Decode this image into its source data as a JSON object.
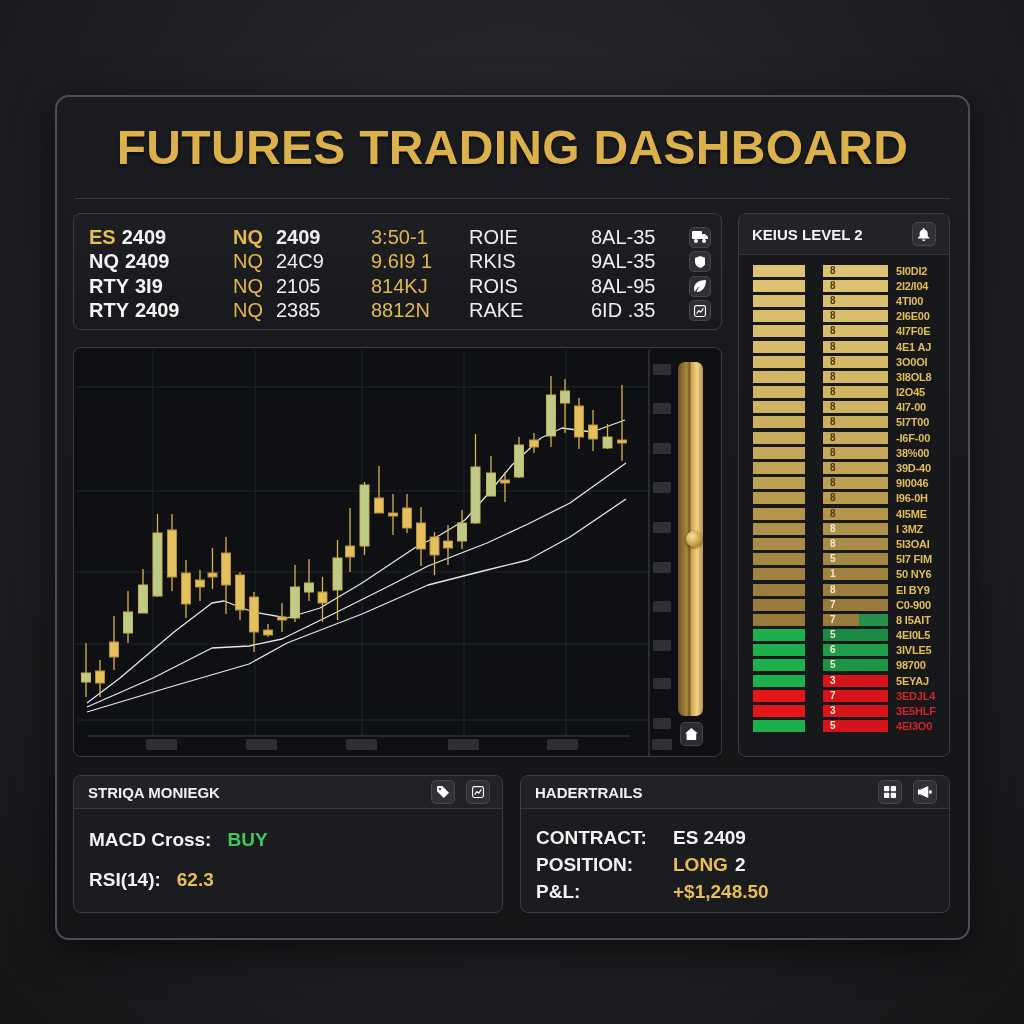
{
  "title": "FUTURES TRADING DASHBOARD",
  "ticker": {
    "rows": [
      {
        "selected": true,
        "symbol": "ES",
        "contract": "2409",
        "cells": [
          "NQ",
          "2409",
          "3:50-1",
          "ROIE",
          "8AL-35"
        ]
      },
      {
        "selected": false,
        "symbol": "NQ",
        "contract": "2409",
        "cells": [
          "NQ",
          "24C9",
          "9.6I9 1",
          "RKIS",
          "9AL-35"
        ]
      },
      {
        "selected": false,
        "symbol": "RTY",
        "contract": "3I9",
        "cells": [
          "NQ",
          "2105",
          "814KJ",
          "ROIS",
          "8AL-95"
        ]
      },
      {
        "selected": false,
        "symbol": "RTY",
        "contract": "2409",
        "cells": [
          "NQ",
          "2385",
          "8812N",
          "RAKE",
          "6ID .35"
        ]
      }
    ]
  },
  "chart": {
    "zoom_slider": {
      "level": 0.5
    }
  },
  "level2": {
    "title": "KEIUS LEVEL 2",
    "rows": [
      {
        "left": {
          "color": "#dcc272"
        },
        "right": {
          "color": "#dcc272",
          "label": "8"
        },
        "price": {
          "text": "5I0DI2",
          "color": "#e2be55"
        }
      },
      {
        "left": {
          "color": "#dbc170"
        },
        "right": {
          "color": "#dbc170",
          "label": "8"
        },
        "price": {
          "text": "2I2/I04",
          "color": "#e2be55"
        }
      },
      {
        "left": {
          "color": "#dac06e"
        },
        "right": {
          "color": "#dac06e",
          "label": "8"
        },
        "price": {
          "text": "4TI00",
          "color": "#e2be55"
        }
      },
      {
        "left": {
          "color": "#d9be6c"
        },
        "right": {
          "color": "#d9be6c",
          "label": "8"
        },
        "price": {
          "text": "2I6E00",
          "color": "#e2be55"
        }
      },
      {
        "left": {
          "color": "#d8bd6a"
        },
        "right": {
          "color": "#d8bd6a",
          "label": "8"
        },
        "price": {
          "text": "4I7F0E",
          "color": "#e2be55"
        }
      },
      {
        "left": {
          "color": "#d7bb68"
        },
        "right": {
          "color": "#d7bb68",
          "label": "8"
        },
        "price": {
          "text": "4E1 AJ",
          "color": "#e2be55"
        }
      },
      {
        "left": {
          "color": "#d5b966"
        },
        "right": {
          "color": "#d5b966",
          "label": "8"
        },
        "price": {
          "text": "3O0OI",
          "color": "#e2be55"
        }
      },
      {
        "left": {
          "color": "#d3b764"
        },
        "right": {
          "color": "#d3b764",
          "label": "8"
        },
        "price": {
          "text": "3I8OL8",
          "color": "#e2be55"
        }
      },
      {
        "left": {
          "color": "#d1b462"
        },
        "right": {
          "color": "#d1b462",
          "label": "8"
        },
        "price": {
          "text": "I2O45",
          "color": "#e2be55"
        }
      },
      {
        "left": {
          "color": "#cfb260"
        },
        "right": {
          "color": "#cfb260",
          "label": "8"
        },
        "price": {
          "text": "4I7-00",
          "color": "#e2be55"
        }
      },
      {
        "left": {
          "color": "#ccaf5e"
        },
        "right": {
          "color": "#ccaf5e",
          "label": "8"
        },
        "price": {
          "text": "5I7T00",
          "color": "#e2be55"
        }
      },
      {
        "left": {
          "color": "#c9ac5b"
        },
        "right": {
          "color": "#c9ac5b",
          "label": "8"
        },
        "price": {
          "text": "-I6F-00",
          "color": "#e2be55"
        }
      },
      {
        "left": {
          "color": "#c5a858"
        },
        "right": {
          "color": "#c5a858",
          "label": "8"
        },
        "price": {
          "text": "38%00",
          "color": "#e2be55"
        }
      },
      {
        "left": {
          "color": "#c1a455"
        },
        "right": {
          "color": "#c1a455",
          "label": "8"
        },
        "price": {
          "text": "39D-40",
          "color": "#e2be55"
        }
      },
      {
        "left": {
          "color": "#bda052"
        },
        "right": {
          "color": "#bda052",
          "label": "8"
        },
        "price": {
          "text": "9I0046",
          "color": "#e2be55"
        }
      },
      {
        "left": {
          "color": "#b89b4f"
        },
        "right": {
          "color": "#b89b4f",
          "label": "8"
        },
        "price": {
          "text": "I96-0H",
          "color": "#e2be55"
        }
      },
      {
        "left": {
          "color": "#b3964c"
        },
        "right": {
          "color": "#b3964c",
          "label": "8"
        },
        "price": {
          "text": "4I5ME",
          "color": "#e2be55"
        }
      },
      {
        "left": {
          "color": "#ae9149"
        },
        "right": {
          "color": "#ae9149",
          "label": "8"
        },
        "price": {
          "text": "I 3MZ",
          "color": "#e2be55"
        }
      },
      {
        "left": {
          "color": "#a98c46"
        },
        "right": {
          "color": "#a98c46",
          "label": "8"
        },
        "price": {
          "text": "5I3OAI",
          "color": "#e2be55"
        }
      },
      {
        "left": {
          "color": "#a48743"
        },
        "right": {
          "color": "#a48743",
          "label": "5"
        },
        "price": {
          "text": "5I7 FIM",
          "color": "#e2be55"
        }
      },
      {
        "left": {
          "color": "#a08341"
        },
        "right": {
          "color": "#a08341",
          "label": "1"
        },
        "price": {
          "text": "50 NY6",
          "color": "#e2be55"
        }
      },
      {
        "left": {
          "color": "#9c7f3f"
        },
        "right": {
          "color": "#9c7f3f",
          "label": "8"
        },
        "price": {
          "text": "EI BY9",
          "color": "#e2be55"
        }
      },
      {
        "left": {
          "color": "#997c3d"
        },
        "right": {
          "color": "#997c3d",
          "label": "7"
        },
        "price": {
          "text": "C0-900",
          "color": "#e2be55"
        }
      },
      {
        "left": {
          "color": "#977a3c"
        },
        "right": {
          "color": "#977a3c",
          "label": "7",
          "segment": {
            "color": "#24904b"
          }
        },
        "price": {
          "text": "8 I5AIT",
          "color": "#e2be55"
        }
      },
      {
        "left": {
          "color": "#1fb04e"
        },
        "right": {
          "color": "#1c8a44",
          "label": "5"
        },
        "price": {
          "text": "4EI0L5",
          "color": "#e2be55"
        }
      },
      {
        "left": {
          "color": "#1fb04e"
        },
        "right": {
          "color": "#1f9f4c",
          "label": "6"
        },
        "price": {
          "text": "3IVLE5",
          "color": "#e2be55"
        }
      },
      {
        "left": {
          "color": "#1fb04e"
        },
        "right": {
          "color": "#1b9444",
          "label": "5"
        },
        "price": {
          "text": "98700",
          "color": "#e2be55"
        }
      },
      {
        "left": {
          "color": "#1fb04e"
        },
        "right": {
          "color": "#d5141b",
          "label": "3"
        },
        "price": {
          "text": "5EYAJ",
          "color": "#e2be55"
        }
      },
      {
        "left": {
          "color": "#e3161a"
        },
        "right": {
          "color": "#d5141b",
          "label": "7"
        },
        "price": {
          "text": "3EDJL4",
          "color": "#d0262a"
        }
      },
      {
        "left": {
          "color": "#e3161a"
        },
        "right": {
          "color": "#d5141b",
          "label": "3"
        },
        "price": {
          "text": "3E5HLF",
          "color": "#d0262a"
        }
      },
      {
        "left": {
          "color": "#1fb04e"
        },
        "right": {
          "color": "#d5141b",
          "label": "5"
        },
        "price": {
          "text": "4EI3O0",
          "color": "#d0262a"
        }
      }
    ]
  },
  "signals": {
    "title": "STRIQA MONIEGK",
    "rows": [
      {
        "label": "MACD Cross:",
        "value": "BUY",
        "color": "#42c65a"
      },
      {
        "label": "RSI(14):",
        "value": "62.3",
        "color": "#e8bf52"
      }
    ]
  },
  "trade": {
    "title": "HADERTRAILS",
    "rows": [
      {
        "label": "CONTRACT:",
        "parts": [
          {
            "text": "ES 2409",
            "color": "#f4f4f4"
          }
        ]
      },
      {
        "label": "POSITION:",
        "parts": [
          {
            "text": "LONG",
            "color": "#e8bf52"
          },
          {
            "text": "2",
            "color": "#f4f4f4"
          }
        ]
      },
      {
        "label": "P&L:",
        "parts": [
          {
            "text": "+$1,248.50",
            "color": "#e8bf52"
          }
        ]
      }
    ]
  }
}
